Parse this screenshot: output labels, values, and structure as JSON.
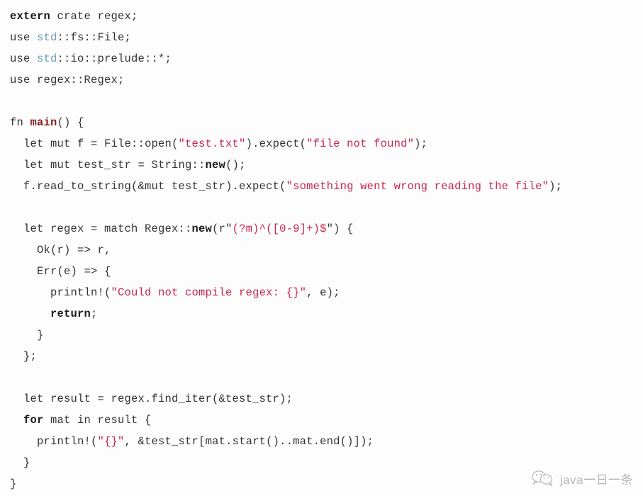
{
  "colors": {
    "background": "#fdfdfd",
    "plain_text": "#333333",
    "keyword": "#1a1a1a",
    "function_name": "#8b1a1a",
    "module": "#6c9ab8",
    "string": "#c7254e",
    "watermark_text": "#6f6f6f"
  },
  "code": {
    "language": "rust",
    "lines": [
      {
        "id": "line-1",
        "tokens": [
          {
            "t": "extern",
            "c": "keyword"
          },
          {
            "t": " crate regex;",
            "c": "plain"
          }
        ]
      },
      {
        "id": "line-2",
        "tokens": [
          {
            "t": "use ",
            "c": "plain"
          },
          {
            "t": "std",
            "c": "module"
          },
          {
            "t": "::fs::File;",
            "c": "plain"
          }
        ]
      },
      {
        "id": "line-3",
        "tokens": [
          {
            "t": "use ",
            "c": "plain"
          },
          {
            "t": "std",
            "c": "module"
          },
          {
            "t": "::io::prelude::*;",
            "c": "plain"
          }
        ]
      },
      {
        "id": "line-4",
        "tokens": [
          {
            "t": "use regex::Regex;",
            "c": "plain"
          }
        ]
      },
      {
        "id": "line-5",
        "tokens": [
          {
            "t": "",
            "c": "plain"
          }
        ]
      },
      {
        "id": "line-6",
        "tokens": [
          {
            "t": "fn ",
            "c": "plain"
          },
          {
            "t": "main",
            "c": "fnname"
          },
          {
            "t": "() {",
            "c": "plain"
          }
        ]
      },
      {
        "id": "line-7",
        "tokens": [
          {
            "t": "  let mut f = File::open(",
            "c": "plain"
          },
          {
            "t": "\"test.txt\"",
            "c": "string"
          },
          {
            "t": ").expect(",
            "c": "plain"
          },
          {
            "t": "\"file not found\"",
            "c": "string"
          },
          {
            "t": ");",
            "c": "plain"
          }
        ]
      },
      {
        "id": "line-8",
        "tokens": [
          {
            "t": "  let mut test_str = String::",
            "c": "plain"
          },
          {
            "t": "new",
            "c": "keyword"
          },
          {
            "t": "();",
            "c": "plain"
          }
        ]
      },
      {
        "id": "line-9",
        "tokens": [
          {
            "t": "  f.read_to_string(&mut test_str).expect(",
            "c": "plain"
          },
          {
            "t": "\"something went wrong reading the file\"",
            "c": "string"
          },
          {
            "t": ");",
            "c": "plain"
          }
        ]
      },
      {
        "id": "line-10",
        "tokens": [
          {
            "t": "",
            "c": "plain"
          }
        ]
      },
      {
        "id": "line-11",
        "tokens": [
          {
            "t": "  let regex = match Regex::",
            "c": "plain"
          },
          {
            "t": "new",
            "c": "keyword"
          },
          {
            "t": "(r\"",
            "c": "plain"
          },
          {
            "t": "(?m)^([0-9]+)$",
            "c": "string"
          },
          {
            "t": "\") {",
            "c": "plain"
          }
        ]
      },
      {
        "id": "line-12",
        "tokens": [
          {
            "t": "    Ok(r) => r,",
            "c": "plain"
          }
        ]
      },
      {
        "id": "line-13",
        "tokens": [
          {
            "t": "    Err(e) => {",
            "c": "plain"
          }
        ]
      },
      {
        "id": "line-14",
        "tokens": [
          {
            "t": "      println!(",
            "c": "plain"
          },
          {
            "t": "\"Could not compile regex: {}\"",
            "c": "string"
          },
          {
            "t": ", e);",
            "c": "plain"
          }
        ]
      },
      {
        "id": "line-15",
        "tokens": [
          {
            "t": "      ",
            "c": "plain"
          },
          {
            "t": "return",
            "c": "keyword"
          },
          {
            "t": ";",
            "c": "plain"
          }
        ]
      },
      {
        "id": "line-16",
        "tokens": [
          {
            "t": "    }",
            "c": "plain"
          }
        ]
      },
      {
        "id": "line-17",
        "tokens": [
          {
            "t": "  };",
            "c": "plain"
          }
        ]
      },
      {
        "id": "line-18",
        "tokens": [
          {
            "t": "",
            "c": "plain"
          }
        ]
      },
      {
        "id": "line-19",
        "tokens": [
          {
            "t": "  let result = regex.find_iter(&test_str);",
            "c": "plain"
          }
        ]
      },
      {
        "id": "line-20",
        "tokens": [
          {
            "t": "  ",
            "c": "plain"
          },
          {
            "t": "for",
            "c": "keyword"
          },
          {
            "t": " mat in result {",
            "c": "plain"
          }
        ]
      },
      {
        "id": "line-21",
        "tokens": [
          {
            "t": "    println!(",
            "c": "plain"
          },
          {
            "t": "\"{}\"",
            "c": "string"
          },
          {
            "t": ", &test_str[mat.start()..mat.end()]);",
            "c": "plain"
          }
        ]
      },
      {
        "id": "line-22",
        "tokens": [
          {
            "t": "  }",
            "c": "plain"
          }
        ]
      },
      {
        "id": "line-23",
        "tokens": [
          {
            "t": "}",
            "c": "plain"
          }
        ]
      }
    ]
  },
  "watermark": {
    "icon": "wechat-icon",
    "text": "java一日一条"
  }
}
